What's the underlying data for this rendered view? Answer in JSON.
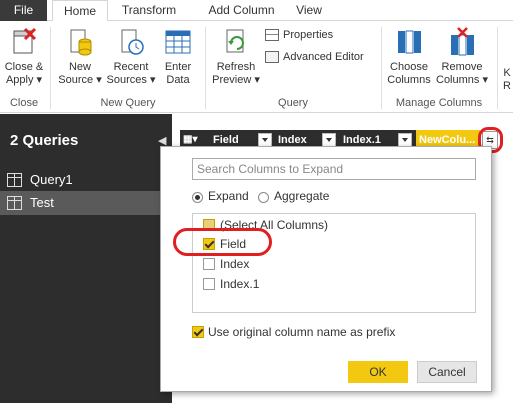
{
  "tabs": {
    "file": "File",
    "home": "Home",
    "transform": "Transform",
    "add_column": "Add Column",
    "view": "View"
  },
  "ribbon": {
    "close_apply": [
      "Close &",
      "Apply ▾"
    ],
    "new_source": [
      "New",
      "Source ▾"
    ],
    "recent_sources": [
      "Recent",
      "Sources ▾"
    ],
    "enter_data": [
      "Enter",
      "Data"
    ],
    "refresh_preview": [
      "Refresh",
      "Preview ▾"
    ],
    "properties": "Properties",
    "advanced_editor": "Advanced Editor",
    "choose_columns": [
      "Choose",
      "Columns"
    ],
    "remove_columns": [
      "Remove",
      "Columns ▾"
    ],
    "groups": {
      "close": "Close",
      "new_query": "New Query",
      "query": "Query",
      "manage_columns": "Manage Columns"
    },
    "cutoff_labels": [
      "K",
      "R"
    ]
  },
  "queries": {
    "title": "2 Queries",
    "items": [
      "Query1",
      "Test"
    ],
    "selected": "Test"
  },
  "columns": {
    "headers": [
      "Field",
      "Index",
      "Index.1",
      "NewColu..."
    ],
    "expand_glyph": "⇆"
  },
  "dialog": {
    "search_placeholder": "Search Columns to Expand",
    "expand_label": "Expand",
    "aggregate_label": "Aggregate",
    "mode": "Expand",
    "items": [
      {
        "label": "(Select All Columns)",
        "state": "partial"
      },
      {
        "label": "Field",
        "state": "checked"
      },
      {
        "label": "Index",
        "state": "unchecked"
      },
      {
        "label": "Index.1",
        "state": "unchecked"
      }
    ],
    "prefix_label": "Use original column name as prefix",
    "prefix_checked": true,
    "ok": "OK",
    "cancel": "Cancel"
  },
  "colors": {
    "accent_yellow": "#f2c811",
    "highlight_red": "#e02020",
    "dark_panel": "#2d2d2d"
  }
}
